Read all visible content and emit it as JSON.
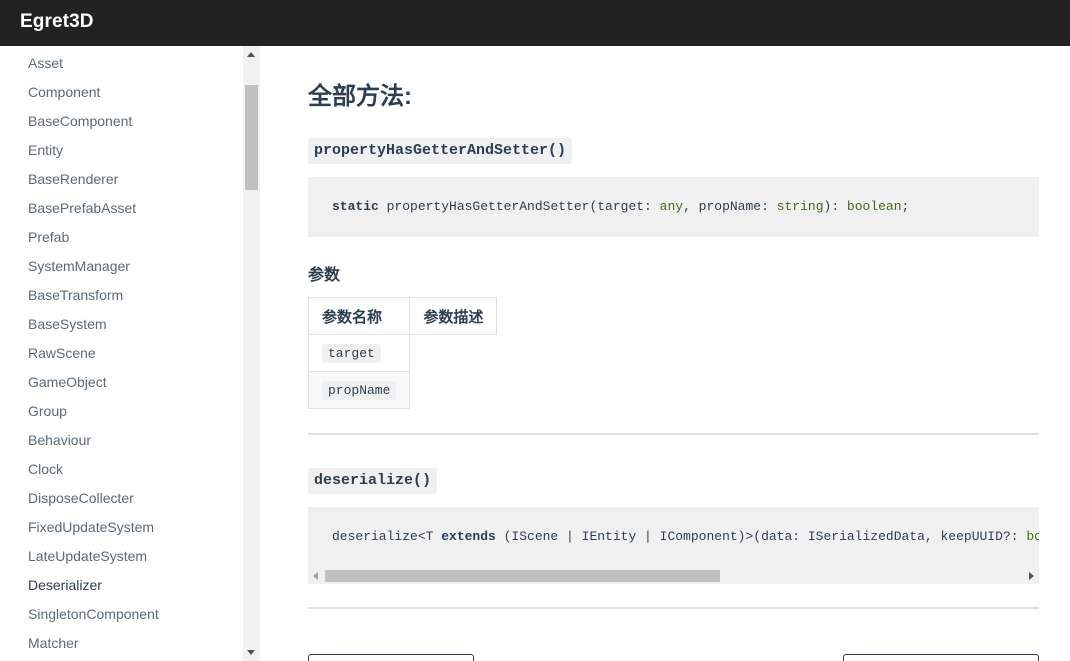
{
  "header": {
    "brand": "Egret3D"
  },
  "sidebar": {
    "items": [
      {
        "label": "Asset"
      },
      {
        "label": "Component"
      },
      {
        "label": "BaseComponent"
      },
      {
        "label": "Entity"
      },
      {
        "label": "BaseRenderer"
      },
      {
        "label": "BasePrefabAsset"
      },
      {
        "label": "Prefab"
      },
      {
        "label": "SystemManager"
      },
      {
        "label": "BaseTransform"
      },
      {
        "label": "BaseSystem"
      },
      {
        "label": "RawScene"
      },
      {
        "label": "GameObject"
      },
      {
        "label": "Group"
      },
      {
        "label": "Behaviour"
      },
      {
        "label": "Clock"
      },
      {
        "label": "DisposeCollecter"
      },
      {
        "label": "FixedUpdateSystem"
      },
      {
        "label": "LateUpdateSystem"
      },
      {
        "label": "Deserializer"
      },
      {
        "label": "SingletonComponent"
      },
      {
        "label": "Matcher"
      }
    ],
    "active_label": "Deserializer"
  },
  "main": {
    "section_title": "全部方法:",
    "methods": [
      {
        "name": "propertyHasGetterAndSetter()",
        "signature": {
          "static_kw": "static",
          "fn_open": " propertyHasGetterAndSetter(target: ",
          "type1": "any",
          "mid": ", propName: ",
          "type2": "string",
          "ret_sep": "): ",
          "type3": "boolean",
          "end": ";"
        },
        "params_heading": "参数",
        "params_headers": [
          "参数名称",
          "参数描述"
        ],
        "params": [
          {
            "name": "target",
            "desc": ""
          },
          {
            "name": "propName",
            "desc": ""
          }
        ]
      },
      {
        "name": "deserialize()",
        "signature": {
          "p1": "deserialize<T ",
          "kw": "extends",
          "p2": " (IScene | IEntity | IComponent)>(data: ISerializedData, keepUUID?: ",
          "type": "boolean"
        }
      }
    ]
  },
  "colors": {
    "header_bg": "#222222",
    "code_bg": "#f0f0f0",
    "type_color": "#3e6d1a",
    "text": "#2c3e50"
  }
}
